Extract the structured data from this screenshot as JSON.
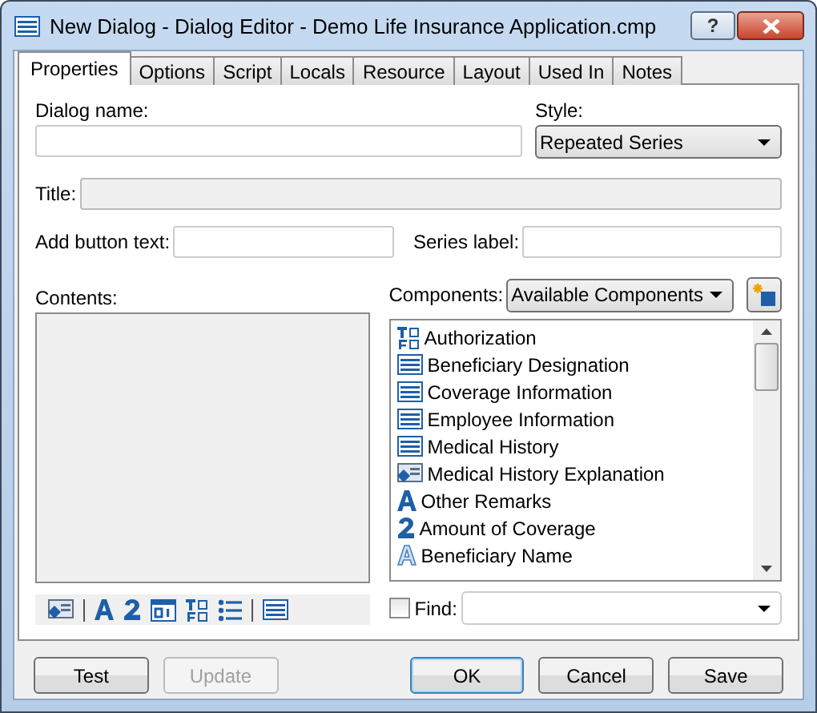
{
  "window": {
    "title": "New Dialog - Dialog Editor - Demo Life Insurance Application.cmp",
    "help": "?"
  },
  "tabs": [
    {
      "label": "Properties",
      "selected": true
    },
    {
      "label": "Options",
      "selected": false
    },
    {
      "label": "Script",
      "selected": false
    },
    {
      "label": "Locals",
      "selected": false
    },
    {
      "label": "Resource",
      "selected": false
    },
    {
      "label": "Layout",
      "selected": false
    },
    {
      "label": "Used In",
      "selected": false
    },
    {
      "label": "Notes",
      "selected": false
    }
  ],
  "properties": {
    "dialog_name": {
      "label": "Dialog name:"
    },
    "style": {
      "label": "Style:",
      "value": "Repeated Series"
    },
    "title": {
      "label": "Title:",
      "disabled": true
    },
    "add_button_text": {
      "label": "Add button text:"
    },
    "series_label": {
      "label": "Series label:"
    },
    "contents": {
      "label": "Contents:"
    },
    "components": {
      "label": "Components:",
      "value": "Available Components"
    },
    "component_list": [
      {
        "kind": "grid",
        "label": "Authorization"
      },
      {
        "kind": "form",
        "label": "Beneficiary Designation"
      },
      {
        "kind": "form",
        "label": "Coverage Information"
      },
      {
        "kind": "form",
        "label": "Employee Information"
      },
      {
        "kind": "form",
        "label": "Medical History"
      },
      {
        "kind": "image-form",
        "label": "Medical History Explanation"
      },
      {
        "kind": "text",
        "label": "Other Remarks"
      },
      {
        "kind": "number",
        "label": "Amount of Coverage"
      },
      {
        "kind": "text-outline",
        "label": "Beneficiary Name"
      }
    ],
    "toolbar": [
      {
        "kind": "image-form"
      },
      {
        "kind": "separator"
      },
      {
        "kind": "text"
      },
      {
        "kind": "number"
      },
      {
        "kind": "date"
      },
      {
        "kind": "grid"
      },
      {
        "kind": "list"
      },
      {
        "kind": "separator"
      },
      {
        "kind": "form"
      }
    ],
    "find": {
      "label": "Find:",
      "checked": false
    }
  },
  "buttons": [
    {
      "label": "Test",
      "disabled": false,
      "default": false
    },
    {
      "label": "Update",
      "disabled": true,
      "default": false
    },
    {
      "label": "OK",
      "disabled": false,
      "default": true
    },
    {
      "label": "Cancel",
      "disabled": false,
      "default": false
    },
    {
      "label": "Save",
      "disabled": false,
      "default": false
    }
  ]
}
